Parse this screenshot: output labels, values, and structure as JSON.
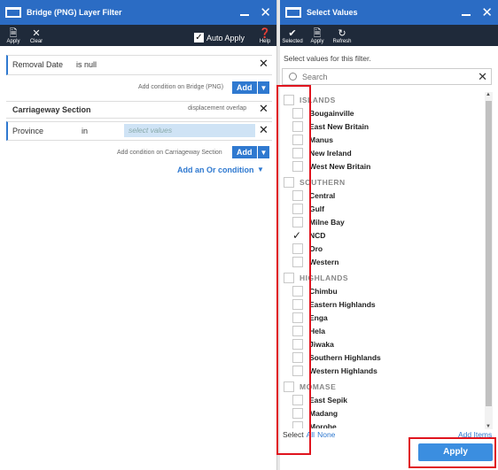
{
  "left_panel": {
    "title": "Bridge (PNG) Layer Filter",
    "toolbar": {
      "apply": "Apply",
      "clear": "Clear",
      "auto_apply": "Auto Apply",
      "help": "Help"
    },
    "condition1": {
      "field": "Removal Date",
      "operator": "is null"
    },
    "add_condition_bridge": "Add condition on Bridge (PNG)",
    "add_label": "Add",
    "section_title": "Carriageway Section",
    "section_note": "displacement overlap",
    "condition2": {
      "field": "Province",
      "operator": "in",
      "placeholder": "select values"
    },
    "add_condition_carriageway": "Add condition on Carriageway Section",
    "add_or": "Add an Or condition"
  },
  "right_panel": {
    "title": "Select Values",
    "toolbar": {
      "selected": "Selected",
      "apply": "Apply",
      "refresh": "Refresh"
    },
    "instruction": "Select values for this filter.",
    "search_placeholder": "Search",
    "groups": [
      {
        "name": "ISLANDS",
        "items": [
          {
            "label": "Bougainville",
            "checked": false
          },
          {
            "label": "East New Britain",
            "checked": false
          },
          {
            "label": "Manus",
            "checked": false
          },
          {
            "label": "New Ireland",
            "checked": false
          },
          {
            "label": "West New Britain",
            "checked": false
          }
        ]
      },
      {
        "name": "SOUTHERN",
        "items": [
          {
            "label": "Central",
            "checked": false
          },
          {
            "label": "Gulf",
            "checked": false
          },
          {
            "label": "Milne Bay",
            "checked": false
          },
          {
            "label": "NCD",
            "checked": true
          },
          {
            "label": "Oro",
            "checked": false
          },
          {
            "label": "Western",
            "checked": false
          }
        ]
      },
      {
        "name": "HIGHLANDS",
        "items": [
          {
            "label": "Chimbu",
            "checked": false
          },
          {
            "label": "Eastern Highlands",
            "checked": false
          },
          {
            "label": "Enga",
            "checked": false
          },
          {
            "label": "Hela",
            "checked": false
          },
          {
            "label": "Jiwaka",
            "checked": false
          },
          {
            "label": "Southern Highlands",
            "checked": false
          },
          {
            "label": "Western Highlands",
            "checked": false
          }
        ]
      },
      {
        "name": "MOMASE",
        "items": [
          {
            "label": "East Sepik",
            "checked": false
          },
          {
            "label": "Madang",
            "checked": false
          },
          {
            "label": "Morobe",
            "checked": false
          }
        ]
      }
    ],
    "footer": {
      "select": "Select",
      "all": "All",
      "none": "None",
      "add_items": "Add Items",
      "apply_button": "Apply"
    }
  },
  "colors": {
    "header": "#2b6cc4",
    "toolbar": "#1f2a3a",
    "accent": "#2f79d0",
    "highlight": "#e0141e"
  }
}
